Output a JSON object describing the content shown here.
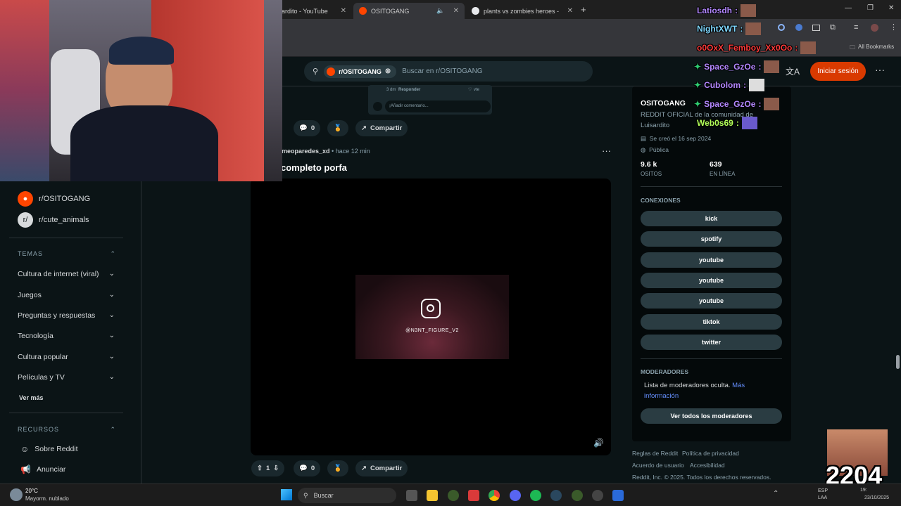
{
  "tabs": [
    {
      "label": "ardito - YouTube"
    },
    {
      "label": "OSITOGANG"
    },
    {
      "label": "plants vs zombies heroes - Busc"
    }
  ],
  "bookmarks": {
    "all_label": "All Bookmarks"
  },
  "header": {
    "community_chip": "r/OSITOGANG",
    "search_placeholder": "Buscar en r/OSITOGANG",
    "login_label": "Iniciar sesión"
  },
  "sidebar": {
    "communities": [
      {
        "label": "r/OSITOGANG",
        "color": "#ff4500"
      },
      {
        "label": "r/cute_animals",
        "color": "#d7dadc"
      }
    ],
    "temas_title": "TEMAS",
    "temas": [
      {
        "label": "Cultura de internet (viral)"
      },
      {
        "label": "Juegos"
      },
      {
        "label": "Preguntas y respuestas"
      },
      {
        "label": "Tecnología"
      },
      {
        "label": "Cultura popular"
      },
      {
        "label": "Películas y TV"
      }
    ],
    "more_label": "Ver más",
    "recursos_title": "RECURSOS",
    "recursos": [
      {
        "label": "Sobre Reddit"
      },
      {
        "label": "Anunciar"
      }
    ]
  },
  "feed": {
    "comment_box": {
      "reply": "Responder",
      "placeholder": "¡Añadir comentario...",
      "time": "3 dm",
      "votes": "vte"
    },
    "prev_post_actions": {
      "comments": "0",
      "share": "Compartir"
    },
    "post": {
      "author": "meoparedes_xd",
      "time": "hace 12 min",
      "title": "completo porfa",
      "ig_handle": "@N3NT_FIGURE_V2",
      "votes": "1",
      "comments": "0",
      "share": "Compartir"
    }
  },
  "right": {
    "name": "OSITOGANG",
    "description": "REDDIT OFICIAL de la comunidad de Luisardito",
    "created": "Se creó el 16 sep 2024",
    "visibility": "Pública",
    "members_value": "9.6 k",
    "members_label": "OSITOS",
    "online_value": "639",
    "online_label": "EN LÍNEA",
    "connections_title": "CONEXIONES",
    "connections": [
      "kick",
      "spotify",
      "youtube",
      "youtube",
      "youtube",
      "tiktok",
      "twitter"
    ],
    "mods_title": "MODERADORES",
    "mods_text": "Lista de moderadores oculta.",
    "mods_link": "Más información",
    "mods_button": "Ver todos los moderadores",
    "footer": [
      "Reglas de Reddit",
      "Política de privacidad",
      "Acuerdo de usuario",
      "Accesibilidad",
      "Reddit, Inc. © 2025. Todos los derechos reservados."
    ]
  },
  "chat": [
    {
      "user": "Latiosdh",
      "color": "#b388ff"
    },
    {
      "user": "NightXWT",
      "color": "#80d8ff"
    },
    {
      "user": "o0OxX_Femboy_Xx0Oo",
      "color": "#ff3b3b"
    },
    {
      "user": "Space_GzOe",
      "color": "#b388ff"
    },
    {
      "user": "Cubolom",
      "color": "#b388ff"
    },
    {
      "user": "Space_GzOe",
      "color": "#b388ff"
    },
    {
      "user": "Web0s69",
      "color": "#b2ff59"
    }
  ],
  "overlay": {
    "big_number": "2204"
  },
  "taskbar": {
    "weather_temp": "20°C",
    "weather_desc": "Mayorm. nublado",
    "search": "Buscar",
    "lang": "ESP LAA",
    "date": "23/10/2025",
    "time": "19:"
  }
}
